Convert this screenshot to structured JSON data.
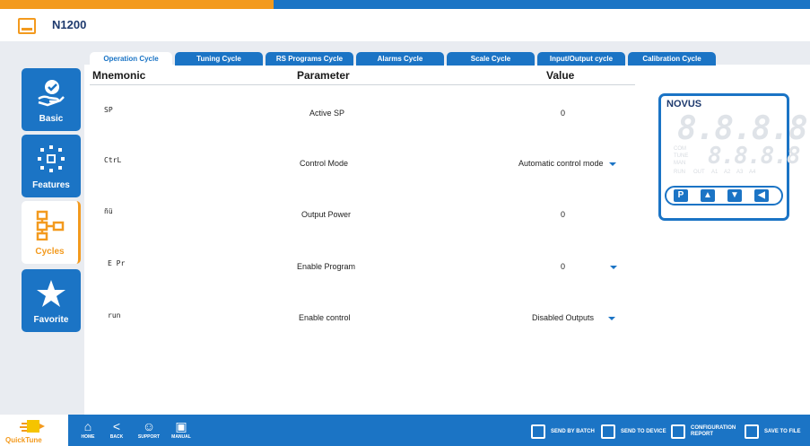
{
  "app": {
    "title": "N1200"
  },
  "tabs": [
    {
      "label": "Operation Cycle",
      "active": true
    },
    {
      "label": "Tuning Cycle"
    },
    {
      "label": "RS Programs Cycle"
    },
    {
      "label": "Alarms Cycle"
    },
    {
      "label": "Scale Cycle"
    },
    {
      "label": "Input/Output cycle"
    },
    {
      "label": "Calibration Cycle"
    }
  ],
  "sidebar": {
    "items": [
      {
        "label": "Basic",
        "icon": "hand-check-icon"
      },
      {
        "label": "Features",
        "icon": "network-icon"
      },
      {
        "label": "Cycles",
        "icon": "flowchart-icon",
        "active": true
      },
      {
        "label": "Favorite",
        "icon": "star-icon"
      }
    ]
  },
  "table": {
    "headers": {
      "mnemonic": "Mnemonic",
      "parameter": "Parameter",
      "value": "Value"
    },
    "rows": [
      {
        "mnemonic": "SP",
        "parameter": "Active SP",
        "value": "0",
        "dropdown": false
      },
      {
        "mnemonic": "CtrL",
        "parameter": "Control Mode",
        "value": "Automatic control mode",
        "dropdown": true
      },
      {
        "mnemonic": "ñü",
        "parameter": "Output Power",
        "value": "0",
        "dropdown": false
      },
      {
        "mnemonic": "E  Pr",
        "parameter": "Enable Program",
        "value": "0",
        "dropdown": true
      },
      {
        "mnemonic": "run",
        "parameter": "Enable control",
        "value": "Disabled Outputs",
        "dropdown": true
      }
    ]
  },
  "device": {
    "brand": "NOVUS",
    "display_top": "8.8.8.8",
    "display_bottom": "8.8.8.8",
    "labels": [
      "COM",
      "TUNE",
      "MAN",
      "RUN",
      "OUT",
      "A1",
      "A2",
      "A3",
      "A4"
    ],
    "buttons": [
      "P",
      "▲",
      "▼",
      "◀"
    ]
  },
  "bottom": {
    "logo_text": "QuickTune",
    "nav": [
      {
        "label": "HOME",
        "icon": "home-icon"
      },
      {
        "label": "BACK",
        "icon": "back-icon"
      },
      {
        "label": "SUPPORT",
        "icon": "support-icon"
      },
      {
        "label": "MANUAL",
        "icon": "manual-icon"
      }
    ],
    "actions": [
      {
        "label": "SEND BY BATCH",
        "icon": "send-batch-icon"
      },
      {
        "label": "SEND TO DEVICE",
        "icon": "send-device-icon"
      },
      {
        "label": "CONFIGURATION REPORT",
        "icon": "report-icon"
      },
      {
        "label": "SAVE TO FILE",
        "icon": "save-icon"
      }
    ]
  },
  "colors": {
    "primary": "#1b74c5",
    "accent": "#f39a1e"
  }
}
